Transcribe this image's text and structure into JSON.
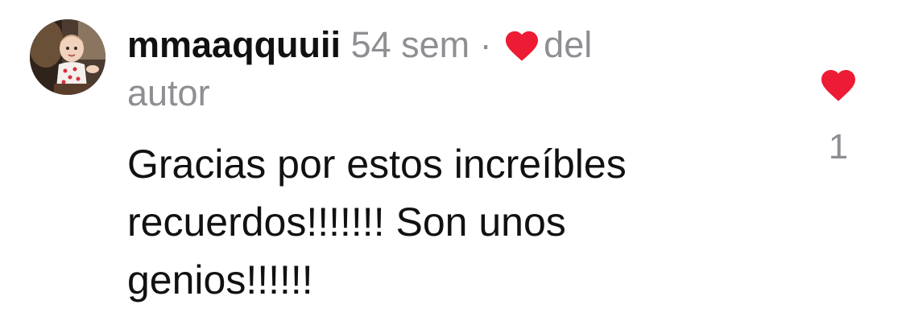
{
  "comment": {
    "username": "mmaaqquuii",
    "time": "54 sem",
    "separator": "·",
    "author_like_prefix": "del",
    "author_like_suffix": "autor",
    "text": "Gracias por estos increíbles recuerdos!!!!!!! Son unos genios!!!!!!",
    "like_count": "1",
    "icons": {
      "author_heart": "heart-icon",
      "like_button": "heart-icon"
    },
    "colors": {
      "heart": "#ed1b34",
      "secondary_text": "#8e8e93",
      "primary_text": "#111111"
    }
  }
}
